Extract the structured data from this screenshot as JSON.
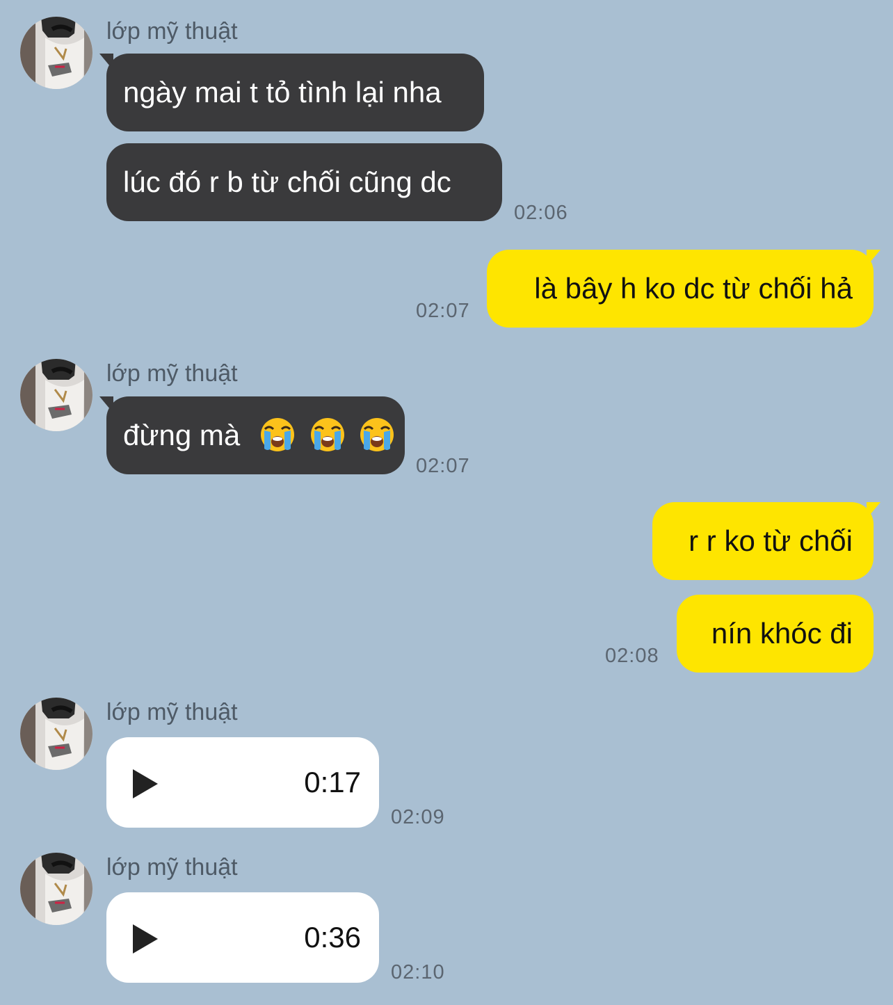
{
  "messages": [
    {
      "sender": "lớp mỹ thuật",
      "texts": [
        "ngày mai t tỏ tình lại nha",
        "lúc đó r b từ chối cũng dc"
      ],
      "time": "02:06"
    },
    {
      "outgoing": true,
      "texts": [
        "là bây h ko dc từ chối hả"
      ],
      "time": "02:07"
    },
    {
      "sender": "lớp mỹ thuật",
      "text": "đừng mà",
      "emoji": [
        "loudly-crying-face",
        "loudly-crying-face",
        "loudly-crying-face"
      ],
      "time": "02:07"
    },
    {
      "outgoing": true,
      "texts": [
        "r r ko từ chối",
        "nín khóc đi"
      ],
      "time": "02:08"
    },
    {
      "sender": "lớp mỹ thuật",
      "voice_duration": "0:17",
      "time": "02:09"
    },
    {
      "sender": "lớp mỹ thuật",
      "voice_duration": "0:36",
      "time": "02:10"
    }
  ],
  "colors": {
    "background": "#a9bfd2",
    "incoming_bubble": "#3a3a3c",
    "outgoing_bubble": "#fee500",
    "voice_bubble": "#ffffff"
  },
  "icons": {
    "play": "play-icon",
    "emoji": "loudly-crying-face"
  }
}
